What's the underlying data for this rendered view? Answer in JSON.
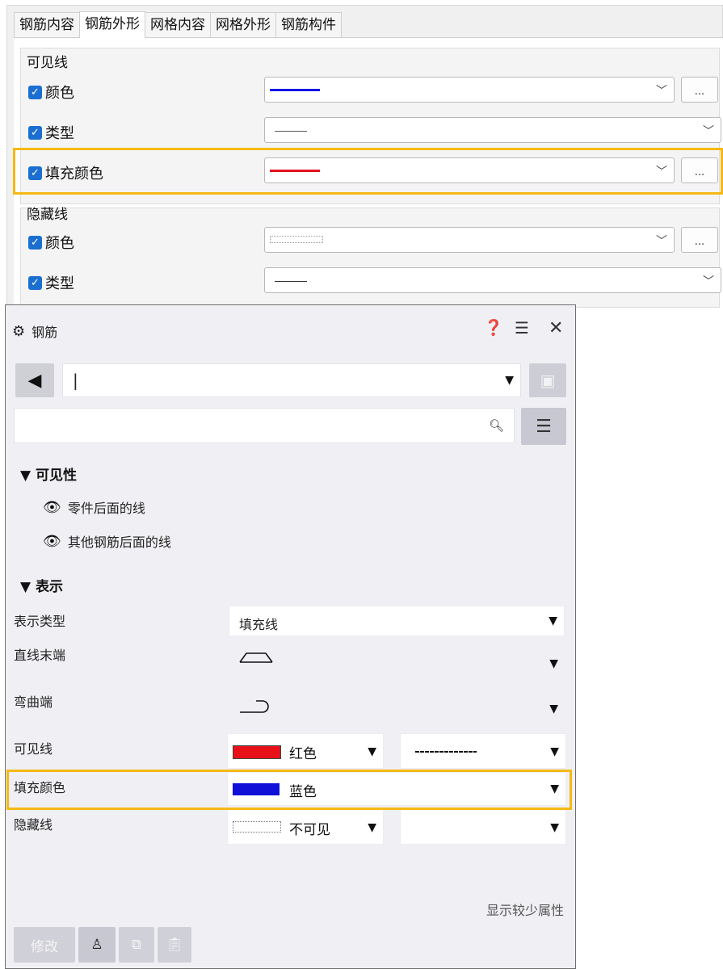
{
  "top_panel": {
    "tabs": [
      "钢筋内容",
      "钢筋外形",
      "网格内容",
      "网格外形",
      "钢筋构件"
    ],
    "active_tab": "钢筋外形",
    "visible_group": {
      "title": "可见线",
      "rows": [
        {
          "label": "颜色",
          "checked": true,
          "line_color": "#1414e6",
          "button": "..."
        },
        {
          "label": "类型",
          "checked": true,
          "line_color": "#555555"
        },
        {
          "label": "填充颜色",
          "checked": true,
          "line_color": "#e0121c",
          "button": "..."
        }
      ]
    },
    "hidden_group": {
      "title": "隐藏线",
      "rows": [
        {
          "label": "颜色",
          "checked": true,
          "button": "..."
        },
        {
          "label": "类型",
          "checked": true,
          "line_color": "#333333"
        }
      ]
    }
  },
  "prop_panel": {
    "title": "钢筋",
    "icons": [
      "settings-icon",
      "help-icon",
      "layout-icon",
      "close-icon"
    ],
    "preset_value": "|",
    "search_placeholder": "",
    "sections": {
      "visibility": {
        "title": "▼ 可见性",
        "items": [
          "零件后面的线",
          "其他钢筋后面的线"
        ]
      },
      "display": {
        "title": "▼ 表示",
        "rows": [
          {
            "label": "表示类型",
            "value": "填充线"
          },
          {
            "label": "直线末端",
            "value": ""
          },
          {
            "label": "弯曲端",
            "value": ""
          },
          {
            "label": "可见线",
            "color_name": "红色",
            "swatch": "#e8111a"
          },
          {
            "label": "填充颜色",
            "color_name": "蓝色",
            "swatch": "#1010d8"
          },
          {
            "label": "隐藏线",
            "color_name": "不可见",
            "swatch": "#ffffff"
          }
        ]
      }
    },
    "show_less": "显示较少属性",
    "modify_button": "修改"
  },
  "colors": {
    "highlight": "#f5b915",
    "checkbox": "#1a6fd0"
  }
}
